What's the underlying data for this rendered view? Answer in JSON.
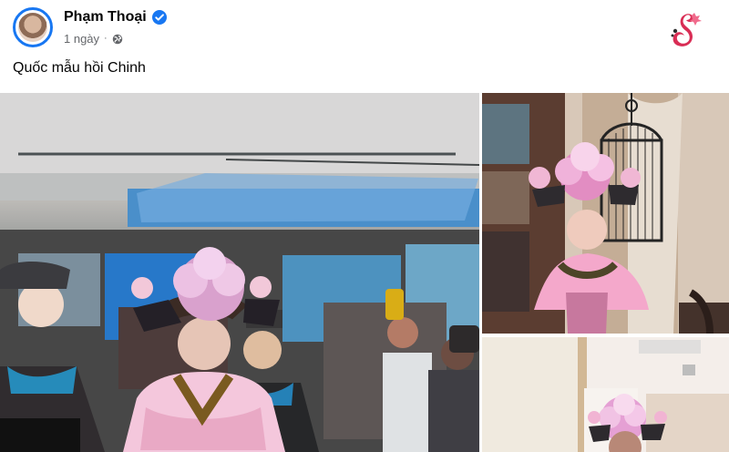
{
  "post": {
    "author_name": "Phạm Thoại",
    "time_ago": "1 ngày",
    "separator": "·",
    "caption": "Quốc mẫu hồi Chinh"
  },
  "icons": {
    "verified": "verified-badge-icon",
    "privacy": "globe-icon",
    "brand": "watermark-logo-icon"
  },
  "colors": {
    "facebook_blue": "#1877f2",
    "text_primary": "#050505",
    "text_secondary": "#65676b",
    "watermark_red": "#d92d55"
  }
}
